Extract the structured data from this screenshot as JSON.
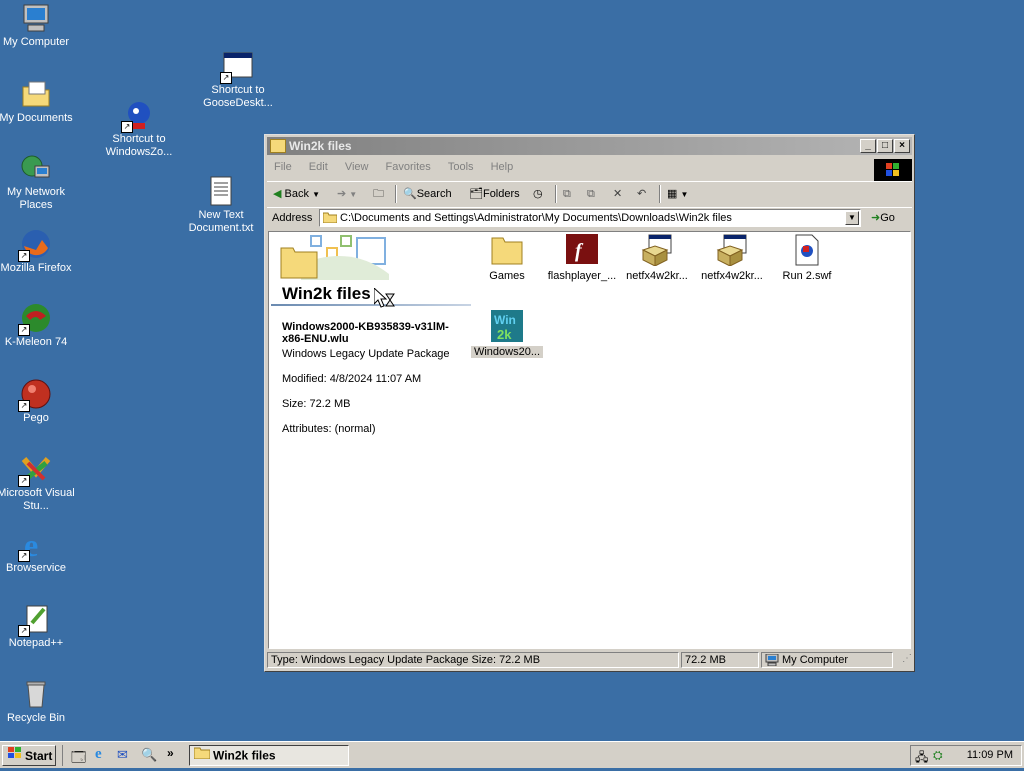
{
  "desktop": {
    "icons": [
      {
        "label": "My Computer"
      },
      {
        "label": "My Documents"
      },
      {
        "label": "My Network Places"
      },
      {
        "label": "Mozilla Firefox"
      },
      {
        "label": "K-Meleon 74"
      },
      {
        "label": "Pego"
      },
      {
        "label": "Microsoft Visual Stu..."
      },
      {
        "label": "Browservice"
      },
      {
        "label": "Notepad++"
      },
      {
        "label": "Recycle Bin"
      },
      {
        "label": "Shortcut to WindowsZo..."
      },
      {
        "label": "Shortcut to GooseDeskt..."
      },
      {
        "label": "New Text Document.txt"
      }
    ]
  },
  "window": {
    "title": "Win2k files",
    "menu": [
      "File",
      "Edit",
      "View",
      "Favorites",
      "Tools",
      "Help"
    ],
    "toolbar": {
      "back": "Back",
      "search": "Search",
      "folders": "Folders"
    },
    "address": {
      "label": "Address",
      "value": "C:\\Documents and Settings\\Administrator\\My Documents\\Downloads\\Win2k files",
      "go": "Go"
    },
    "info_panel": {
      "folder_title": "Win2k files",
      "file_name": "Windows2000-KB935839-v31lM-x86-ENU.wlu",
      "file_type": "Windows Legacy Update Package",
      "modified": "Modified: 4/8/2024 11:07 AM",
      "size": "Size: 72.2 MB",
      "attributes": "Attributes: (normal)"
    },
    "files": [
      {
        "label": "Games"
      },
      {
        "label": "flashplayer_..."
      },
      {
        "label": "netfx4w2kr..."
      },
      {
        "label": "netfx4w2kr..."
      },
      {
        "label": "Run 2.swf"
      },
      {
        "label": "Windows20..."
      }
    ],
    "status": {
      "main": "Type: Windows Legacy Update Package Size: 72.2 MB",
      "size": "72.2 MB",
      "zone": "My Computer"
    }
  },
  "taskbar": {
    "start": "Start",
    "task": "Win2k files",
    "clock": "11:09 PM"
  },
  "colors": {
    "desktop": "#3a6ea5",
    "chrome": "#d4d0c8"
  }
}
